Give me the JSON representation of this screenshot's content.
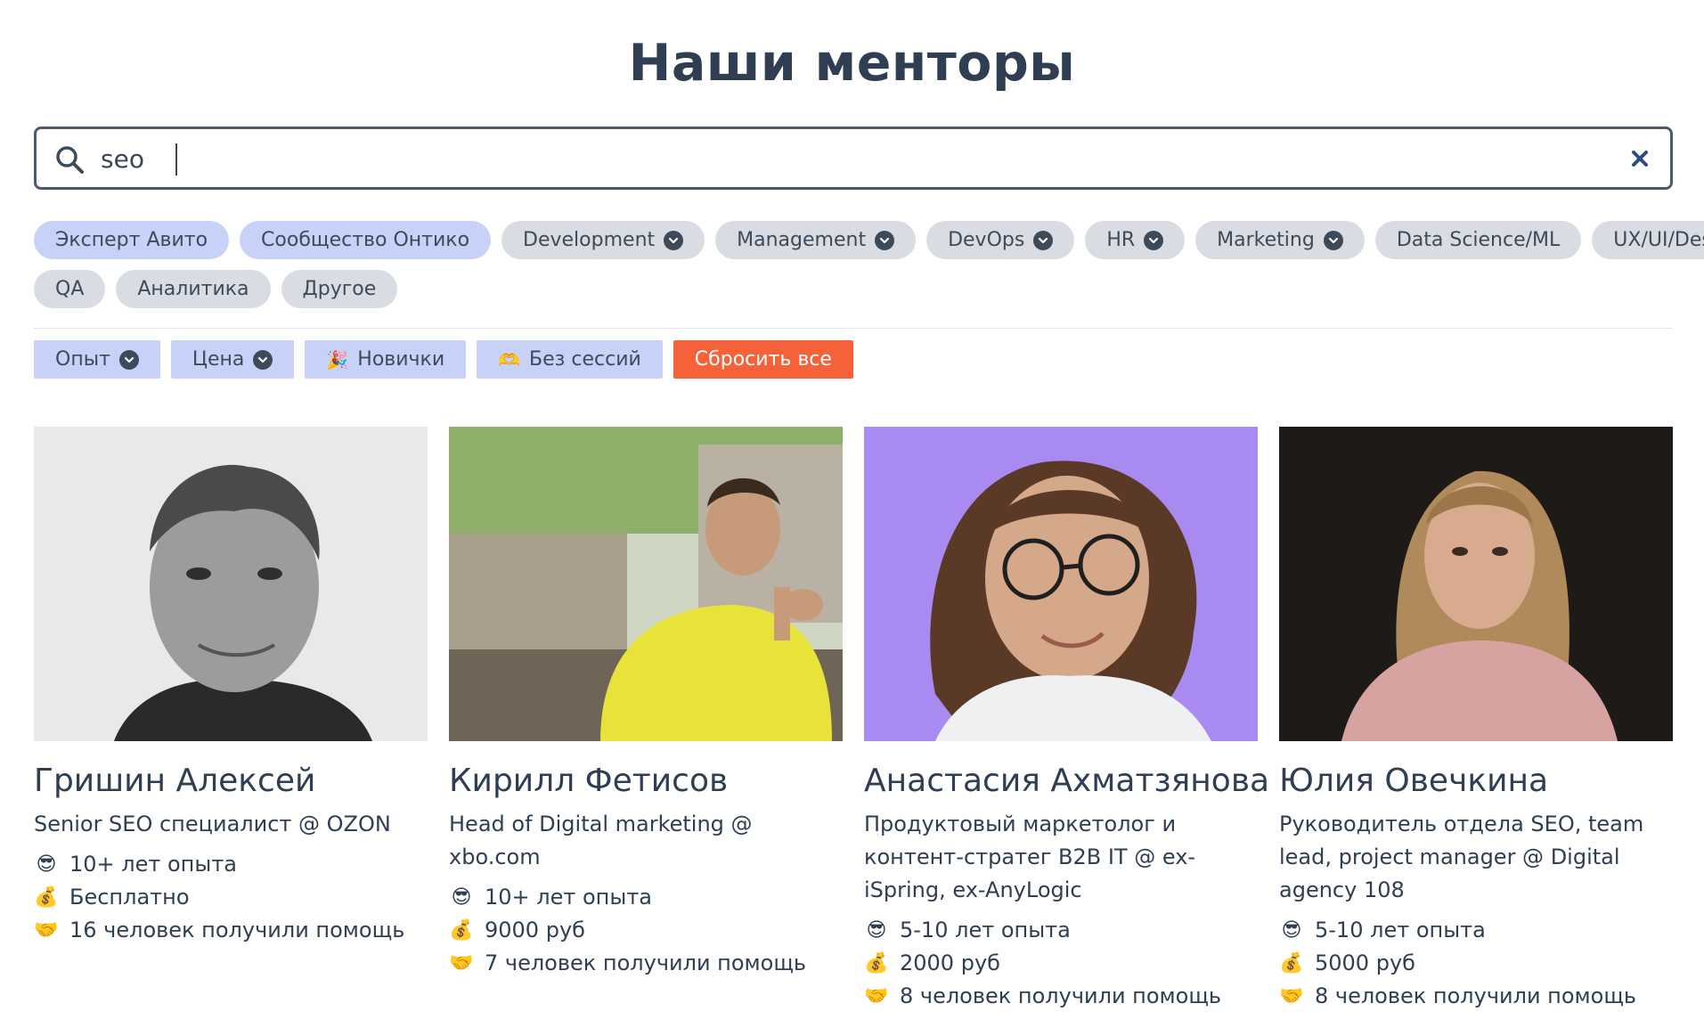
{
  "header": {
    "title": "Наши менторы"
  },
  "search": {
    "value": "seo",
    "placeholder": ""
  },
  "tags": {
    "row1": [
      {
        "label": "Эксперт Авито",
        "accent": true,
        "dropdown": false
      },
      {
        "label": "Сообщество Онтико",
        "accent": true,
        "dropdown": false
      },
      {
        "label": "Development",
        "accent": false,
        "dropdown": true
      },
      {
        "label": "Management",
        "accent": false,
        "dropdown": true
      },
      {
        "label": "DevOps",
        "accent": false,
        "dropdown": true
      },
      {
        "label": "HR",
        "accent": false,
        "dropdown": true
      },
      {
        "label": "Marketing",
        "accent": false,
        "dropdown": true
      },
      {
        "label": "Data Science/ML",
        "accent": false,
        "dropdown": false
      },
      {
        "label": "UX/UI/Design",
        "accent": false,
        "dropdown": false
      }
    ],
    "row2": [
      {
        "label": "QA",
        "accent": false,
        "dropdown": false
      },
      {
        "label": "Аналитика",
        "accent": false,
        "dropdown": false
      },
      {
        "label": "Другое",
        "accent": false,
        "dropdown": false
      }
    ]
  },
  "filters": {
    "experience": "Опыт",
    "price": "Цена",
    "newcomers": "Новички",
    "newcomers_icon": "🎉",
    "no_sessions": "Без сессий",
    "no_sessions_icon": "🫶",
    "reset": "Сбросить все"
  },
  "icons": {
    "experience": "😎",
    "price": "💰",
    "helped": "🤝"
  },
  "colors": {
    "accent_tag": "#c8d2f8",
    "neutral_tag": "#d9dde3",
    "reset_button": "#f5623a",
    "text": "#2f3e52"
  },
  "mentors": [
    {
      "name": "Гришин Алексей",
      "role": "Senior SEO специалист @ OZON",
      "experience": "10+ лет опыта",
      "price": "Бесплатно",
      "helped": "16 человек получили помощь"
    },
    {
      "name": "Кирилл Фетисов",
      "role": "Head of Digital marketing @ xbo.com",
      "experience": "10+ лет опыта",
      "price": "9000 руб",
      "helped": "7 человек получили помощь"
    },
    {
      "name": "Анастасия Ахматзянова",
      "role": "Продуктовый маркетолог и контент-стратег B2B IT @ ex-iSpring, ex-AnyLogic",
      "experience": "5-10 лет опыта",
      "price": "2000 руб",
      "helped": "8 человек получили помощь"
    },
    {
      "name": "Юлия Овечкина",
      "role": "Руководитель отдела SEO, team lead, project manager @ Digital agency 108",
      "experience": "5-10 лет опыта",
      "price": "5000 руб",
      "helped": "8 человек получили помощь"
    }
  ]
}
